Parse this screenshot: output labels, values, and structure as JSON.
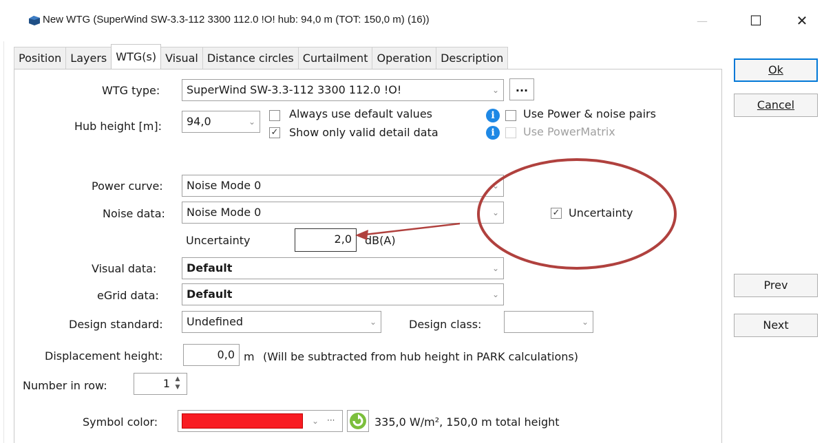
{
  "window": {
    "title": "New WTG   (SuperWind SW-3.3-112 3300 112.0 !O! hub: 94,0 m (TOT: 150,0 m) (16))",
    "min_glyph": "—",
    "max_glyph": "☐",
    "close_glyph": "✕"
  },
  "tabs": [
    {
      "label": "Position"
    },
    {
      "label": "Layers"
    },
    {
      "label": "WTG(s)",
      "active": true
    },
    {
      "label": "Visual"
    },
    {
      "label": "Distance circles"
    },
    {
      "label": "Curtailment"
    },
    {
      "label": "Operation"
    },
    {
      "label": "Description"
    }
  ],
  "form": {
    "wtg_type_label": "WTG type:",
    "wtg_type_value": "SuperWind SW-3.3-112 3300 112.0 !O!",
    "ellipsis_button": "...",
    "hub_height_label": "Hub height [m]:",
    "hub_height_value": "94,0",
    "always_default_label": "Always use default values",
    "always_default_checked": false,
    "show_valid_label": "Show only valid detail data",
    "show_valid_checked": true,
    "use_power_noise_label": "Use Power & noise pairs",
    "use_powermatrix_label": "Use PowerMatrix",
    "power_curve_label": "Power curve:",
    "power_curve_value": "Noise Mode 0",
    "noise_data_label": "Noise data:",
    "noise_data_value": "Noise Mode 0",
    "uncertainty_checkbox_label": "Uncertainty",
    "uncertainty_checked": true,
    "uncertainty_label": "Uncertainty",
    "uncertainty_value": "2,0",
    "uncertainty_unit": "dB(A)",
    "visual_data_label": "Visual data:",
    "visual_data_value": "Default",
    "egrid_data_label": "eGrid data:",
    "egrid_data_value": "Default",
    "design_standard_label": "Design standard:",
    "design_standard_value": "Undefined",
    "design_class_label": "Design class:",
    "design_class_value": "",
    "displacement_label": "Displacement height:",
    "displacement_value": "0,0",
    "displacement_unit": "m",
    "displacement_note": "(Will be subtracted from hub height in PARK calculations)",
    "number_in_row_label": "Number in row:",
    "number_in_row_value": "1",
    "symbol_color_label": "Symbol color:",
    "symbol_color_hex": "#f81c22",
    "symbol_color_ellipsis": "···",
    "summary_text": "335,0 W/m², 150,0 m total height"
  },
  "buttons": {
    "ok": "Ok",
    "cancel": "Cancel",
    "prev": "Prev",
    "next": "Next"
  },
  "annotation": {
    "circle_color": "#b0413e",
    "arrow_color": "#b0413e"
  },
  "icons": {
    "app": "wind-turbine-icon",
    "info": "info-icon",
    "refresh": "refresh-icon",
    "dropdown": "chevron-down-icon"
  }
}
